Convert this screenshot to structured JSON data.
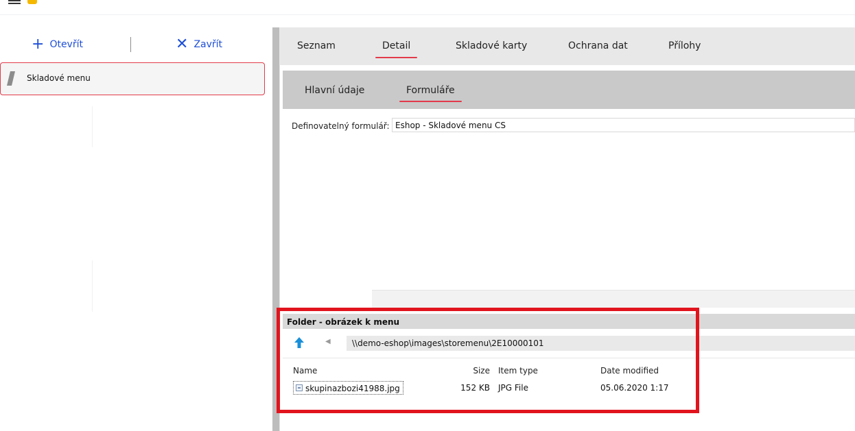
{
  "toolbar": {
    "open_label": "Otevřít",
    "close_label": "Zavřít",
    "open_icon": "plus-icon",
    "close_icon": "x-icon"
  },
  "sidebar": {
    "items": [
      {
        "label": "Skladové menu",
        "icon": "slash-icon"
      }
    ]
  },
  "tabs": [
    "Seznam",
    "Detail",
    "Skladové karty",
    "Ochrana dat",
    "Přílohy"
  ],
  "active_tab": "Detail",
  "subtabs": [
    "Hlavní údaje",
    "Formuláře"
  ],
  "active_subtab": "Formuláře",
  "form": {
    "label": "Definovatelný formulář:",
    "value": "Eshop - Skladové menu CS"
  },
  "folder": {
    "title": "Folder - obrázek k menu",
    "path": "\\\\demo-eshop\\images\\storemenu\\2E10000101",
    "columns": [
      "Name",
      "Size",
      "Item type",
      "Date modified"
    ],
    "files": [
      {
        "name": "skupinazbozi41988.jpg",
        "size": "152 KB",
        "type": "JPG File",
        "modified": "05.06.2020 1:17"
      }
    ]
  },
  "colors": {
    "accent": "#1e4fd6",
    "active_underline": "#e23a4a",
    "highlight_frame": "#e1141e"
  }
}
